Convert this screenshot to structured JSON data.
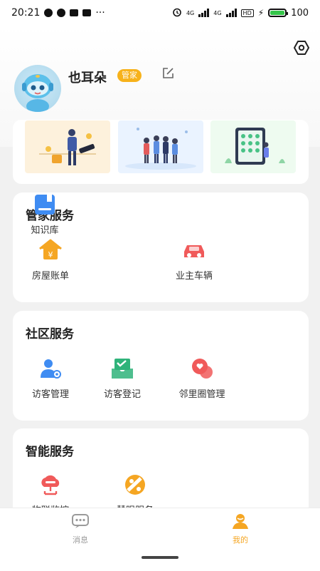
{
  "status_bar": {
    "time": "20:21",
    "more": "···",
    "network": "4G",
    "hd": "HD",
    "battery": "100"
  },
  "header": {
    "username": "也耳朵",
    "role_badge": "管家"
  },
  "sections": [
    {
      "title": "管家服务",
      "items": [
        {
          "label": "房屋账单",
          "icon": "house-bill-icon"
        },
        {
          "label": "知识库",
          "icon": "knowledge-base-icon"
        },
        {
          "label": "业主车辆",
          "icon": "car-icon"
        }
      ]
    },
    {
      "title": "社区服务",
      "items": [
        {
          "label": "访客管理",
          "icon": "visitor-management-icon"
        },
        {
          "label": "访客登记",
          "icon": "visitor-registration-icon"
        },
        {
          "label": "邻里圈管理",
          "icon": "neighbor-circle-icon"
        }
      ]
    },
    {
      "title": "智能服务",
      "items": [
        {
          "label": "物联监控",
          "icon": "iot-monitor-icon"
        },
        {
          "label": "慧眼服务",
          "icon": "smart-eye-icon"
        }
      ]
    }
  ],
  "tabs": [
    {
      "label": "消息",
      "icon": "message-icon",
      "active": false
    },
    {
      "label": "我的",
      "icon": "profile-icon",
      "active": true
    }
  ],
  "colors": {
    "accent": "#f5a623",
    "badge": "#f7b21b",
    "blue": "#3f8cf2",
    "red": "#f05a5a",
    "green": "#2fb37a"
  }
}
